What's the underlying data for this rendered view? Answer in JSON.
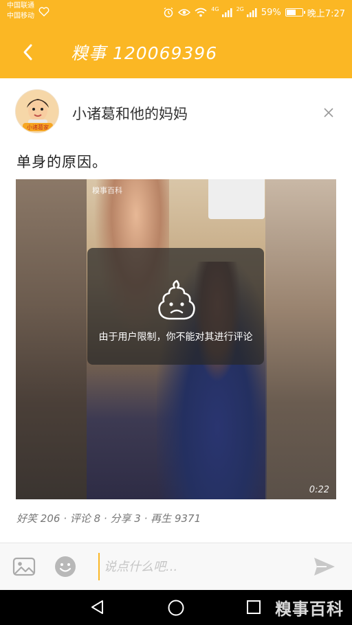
{
  "status_bar": {
    "carrier_1": "中国联通",
    "carrier_2": "中国移动",
    "network_1": "4G",
    "network_2": "2G",
    "battery_text": "59%",
    "battery_level": 0.59,
    "time": "晚上7:27"
  },
  "header": {
    "title": "糗事 120069396",
    "background_color": "#fbb724"
  },
  "post": {
    "author": "小诸葛和他的妈妈",
    "avatar_label": "小诸葛家",
    "text": "单身的原因。",
    "video": {
      "watermark": "糗事百科",
      "duration": "0:22",
      "restriction_message": "由于用户限制，你不能对其进行评论"
    }
  },
  "stats": {
    "funny_label": "好笑",
    "funny_count": "206",
    "comment_label": "评论",
    "comment_count": "8",
    "share_label": "分享",
    "share_count": "3",
    "replay_label": "再生",
    "replay_count": "9371",
    "separator": "·"
  },
  "comment_bar": {
    "placeholder": "说点什么吧..."
  },
  "nav_bar": {
    "watermark": "糗事百科"
  }
}
